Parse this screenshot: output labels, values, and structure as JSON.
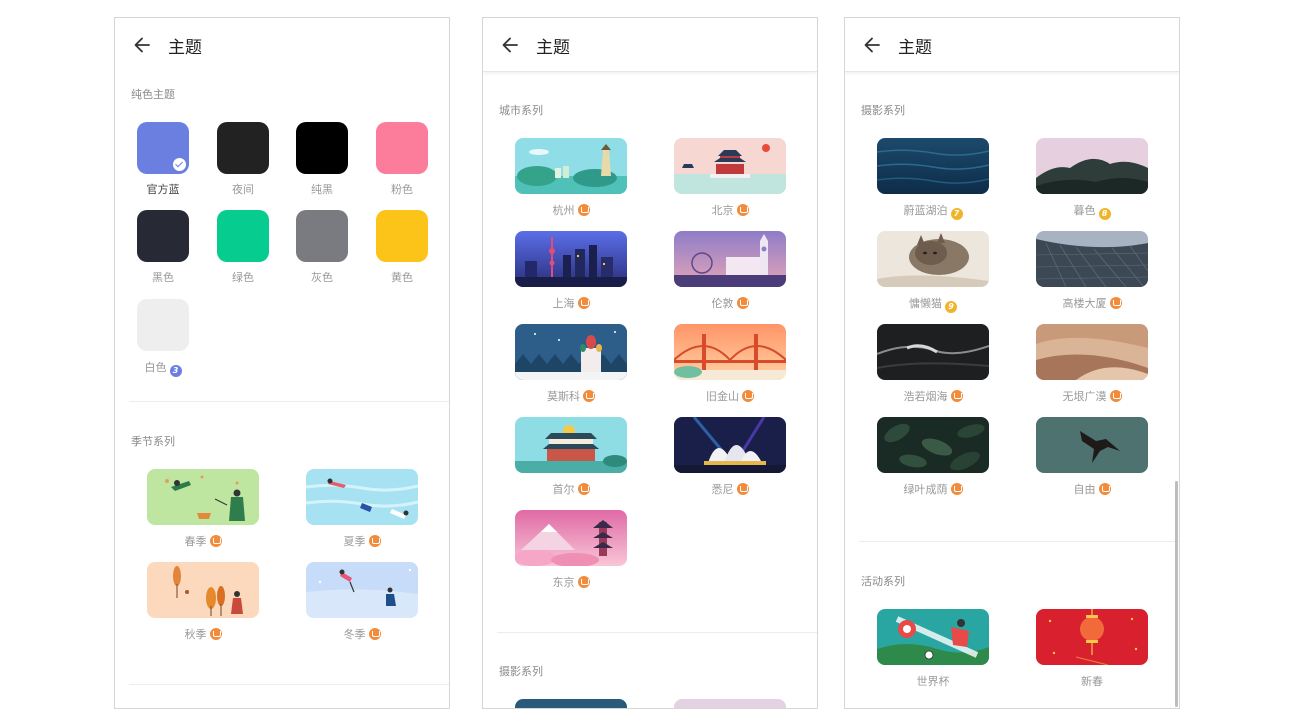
{
  "header": {
    "title": "主题"
  },
  "panel1": {
    "solid_section": "纯色主题",
    "solids": [
      {
        "label": "官方蓝",
        "color": "#6a7fe0",
        "selected": true,
        "badge": ""
      },
      {
        "label": "夜间",
        "color": "#222222",
        "selected": false,
        "badge": ""
      },
      {
        "label": "纯黑",
        "color": "#000000",
        "selected": false,
        "badge": ""
      },
      {
        "label": "粉色",
        "color": "#fb7c9b",
        "selected": false,
        "badge": ""
      },
      {
        "label": "黑色",
        "color": "#272a35",
        "selected": false,
        "badge": ""
      },
      {
        "label": "绿色",
        "color": "#07cc90",
        "selected": false,
        "badge": ""
      },
      {
        "label": "灰色",
        "color": "#7a7b80",
        "selected": false,
        "badge": ""
      },
      {
        "label": "黄色",
        "color": "#fcc319",
        "selected": false,
        "badge": ""
      },
      {
        "label": "白色",
        "color": "#eeeeee",
        "selected": false,
        "badge": "3"
      }
    ],
    "season_section": "季节系列",
    "seasons": [
      {
        "label": "春季"
      },
      {
        "label": "夏季"
      },
      {
        "label": "秋季"
      },
      {
        "label": "冬季"
      }
    ]
  },
  "panel2": {
    "city_section": "城市系列",
    "cities": [
      {
        "label": "杭州"
      },
      {
        "label": "北京"
      },
      {
        "label": "上海"
      },
      {
        "label": "伦敦"
      },
      {
        "label": "莫斯科"
      },
      {
        "label": "旧金山"
      },
      {
        "label": "首尔"
      },
      {
        "label": "悉尼"
      },
      {
        "label": "东京"
      }
    ],
    "photo_section": "摄影系列"
  },
  "panel3": {
    "photo_section": "摄影系列",
    "photos": [
      {
        "label": "蔚蓝湖泊",
        "badge": "7"
      },
      {
        "label": "暮色",
        "badge": "8"
      },
      {
        "label": "慵懒猫",
        "badge": "9"
      },
      {
        "label": "高楼大厦",
        "badge": ""
      },
      {
        "label": "浩若烟海",
        "badge": ""
      },
      {
        "label": "无垠广漠",
        "badge": ""
      },
      {
        "label": "绿叶成荫",
        "badge": ""
      },
      {
        "label": "自由",
        "badge": ""
      }
    ],
    "event_section": "活动系列",
    "events": [
      {
        "label": "世界杯"
      },
      {
        "label": "新春"
      }
    ]
  },
  "icons": {
    "back": "back-arrow-icon",
    "premium": "crown-badge-icon",
    "selected": "check-icon"
  }
}
